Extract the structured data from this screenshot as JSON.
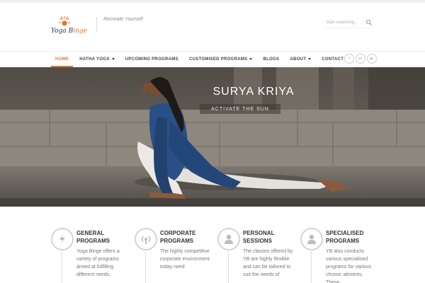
{
  "header": {
    "logo": {
      "text_main": "Yoga B",
      "text_accent": "inge"
    },
    "tagline": "Recreate Yourself",
    "search_placeholder": "Start searching..."
  },
  "nav": {
    "items": [
      {
        "label": "HOME",
        "active": true,
        "dropdown": false
      },
      {
        "label": "HATHA YOGA",
        "active": false,
        "dropdown": true
      },
      {
        "label": "UPCOMING PROGRAMS",
        "active": false,
        "dropdown": false
      },
      {
        "label": "CUSTOMISED PROGRAMS",
        "active": false,
        "dropdown": true
      },
      {
        "label": "BLOGS",
        "active": false,
        "dropdown": false
      },
      {
        "label": "ABOUT",
        "active": false,
        "dropdown": true
      },
      {
        "label": "CONTACT",
        "active": false,
        "dropdown": false
      }
    ],
    "social": [
      {
        "icon": "facebook-icon",
        "glyph": "f"
      },
      {
        "icon": "google-plus-icon",
        "glyph": "g+"
      },
      {
        "icon": "youtube-icon",
        "glyph": "▶"
      }
    ]
  },
  "hero": {
    "title": "SURYA KRIYA",
    "subtitle": "ACTIVATE THE SUN"
  },
  "features": [
    {
      "icon": "lightning-icon",
      "title": "GENERAL PROGRAMS",
      "text": "Yoga Binge offers a variety of programs aimed at fulfilling different needs."
    },
    {
      "icon": "broadcast-icon",
      "title": "CORPORATE PROGRAMS",
      "text": "The highly competitive corporate environment today need"
    },
    {
      "icon": "user-icon",
      "title": "PERSONAL SESSIONS",
      "text": "The classes offered by YB are highly flexible and can be tailored to suit the needs of"
    },
    {
      "icon": "user-icon",
      "title": "SPECIALISED PROGRAMS",
      "text": "YB also conducts various specialised programs for various chronic ailments. These"
    }
  ],
  "colors": {
    "accent": "#e8742a",
    "nav_text": "#444444",
    "hero_bg": "#6e6860"
  }
}
